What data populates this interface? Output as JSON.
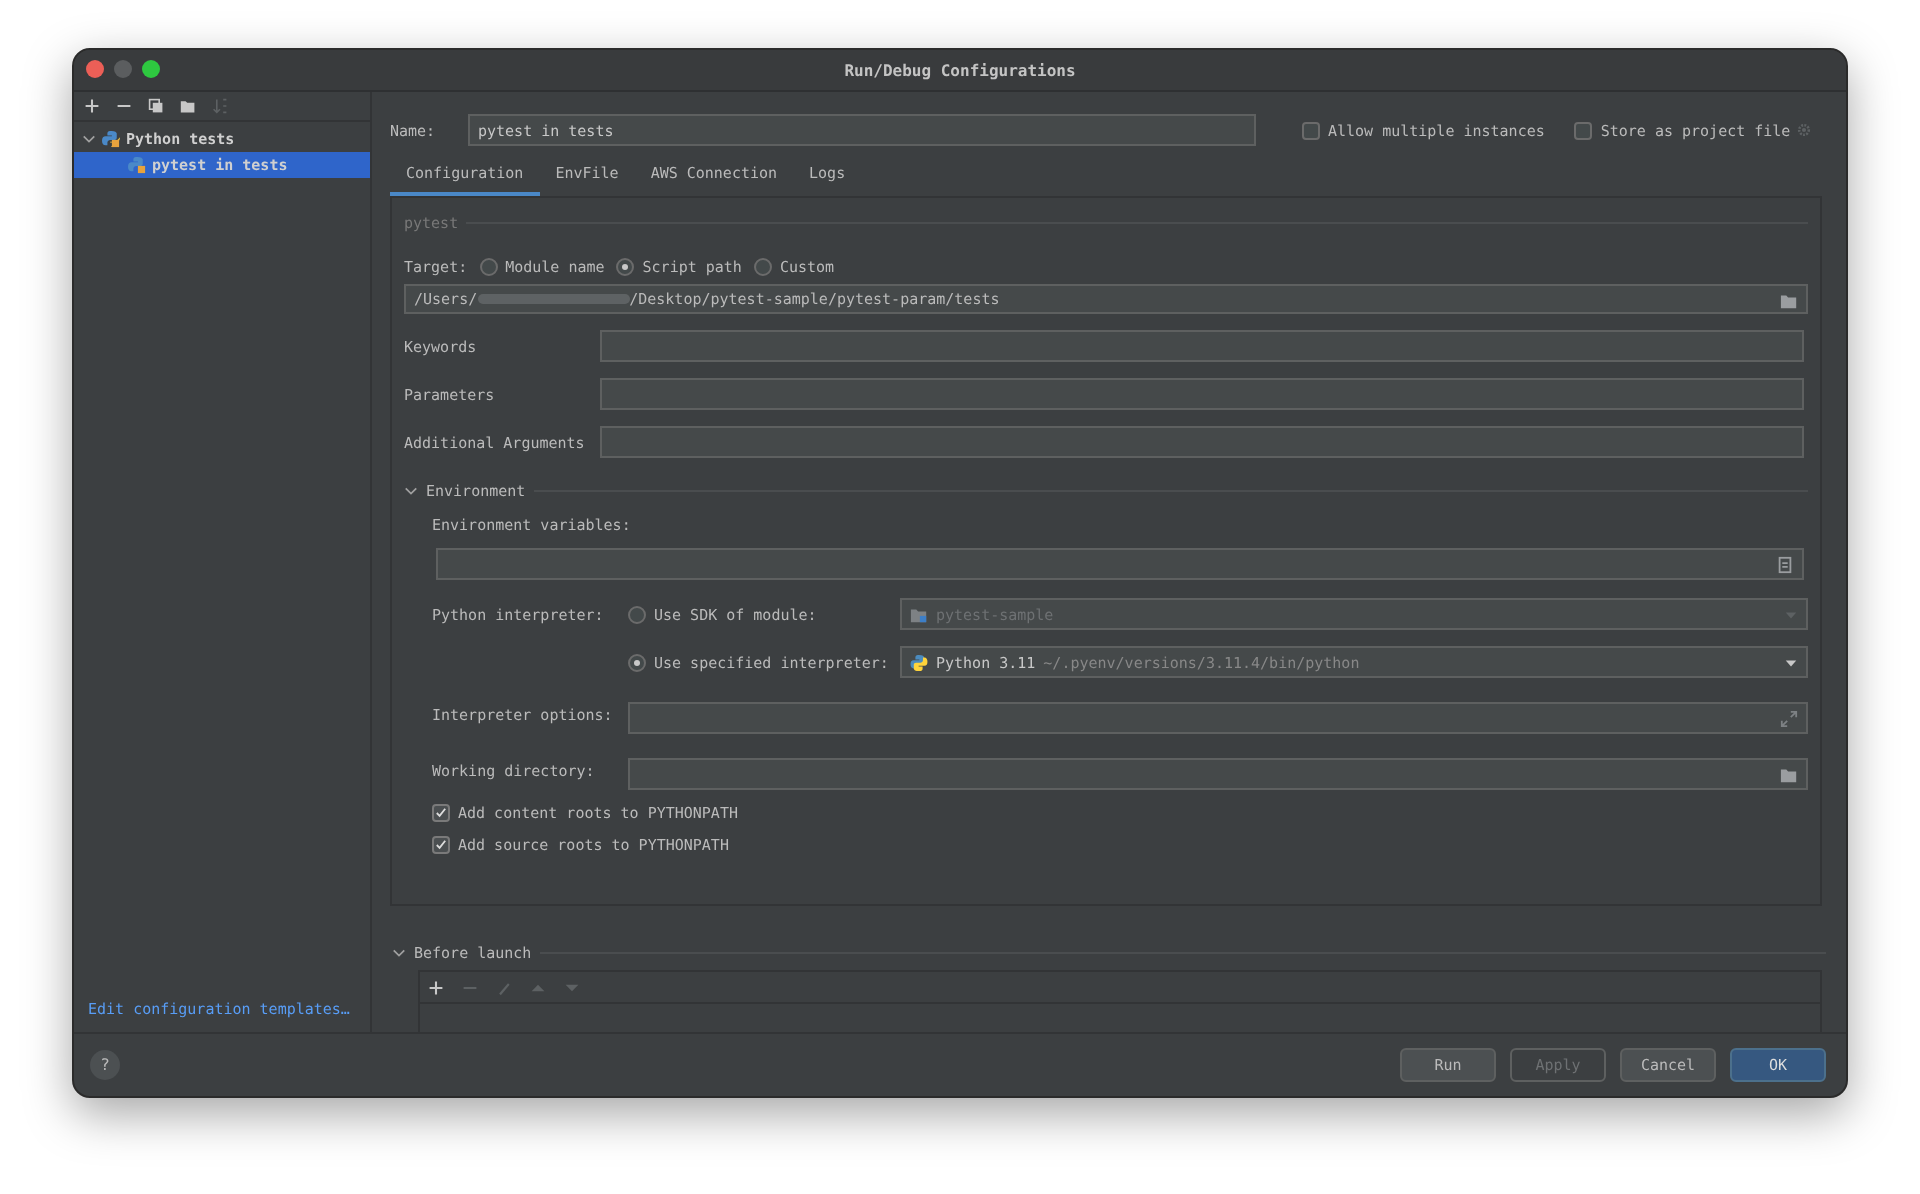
{
  "window": {
    "title": "Run/Debug Configurations"
  },
  "sidebar": {
    "toolbar": [
      {
        "kind": "add",
        "disabled": false
      },
      {
        "kind": "remove",
        "disabled": false
      },
      {
        "kind": "copy",
        "disabled": false
      },
      {
        "kind": "folder",
        "disabled": false
      },
      {
        "kind": "sort",
        "disabled": true
      }
    ],
    "tree": [
      {
        "label": "Python tests",
        "expanded": true,
        "selected": false,
        "children": [
          {
            "label": "pytest in tests",
            "selected": true
          }
        ]
      }
    ],
    "link": "Edit configuration templates…"
  },
  "name": {
    "label": "Name:",
    "value": "pytest in tests"
  },
  "options": [
    {
      "label": "Allow multiple instances",
      "checked": false
    },
    {
      "label": "Store as project file",
      "checked": false
    }
  ],
  "tabs": [
    {
      "label": "Configuration",
      "selected": true
    },
    {
      "label": "EnvFile",
      "selected": false
    },
    {
      "label": "AWS Connection",
      "selected": false
    },
    {
      "label": "Logs",
      "selected": false
    }
  ],
  "pytest": {
    "heading": "pytest",
    "target_label": "Target:",
    "targets": [
      {
        "label": "Module name",
        "selected": false
      },
      {
        "label": "Script path",
        "selected": true
      },
      {
        "label": "Custom",
        "selected": false
      }
    ],
    "path": {
      "prefix": "/Users/",
      "suffix": "/Desktop/pytest-sample/pytest-param/tests"
    },
    "fields": [
      {
        "label": "Keywords"
      },
      {
        "label": "Parameters"
      },
      {
        "label": "Additional Arguments"
      }
    ]
  },
  "environment": {
    "heading": "Environment",
    "expanded": true,
    "env_label": "Environment variables:",
    "interpreter_label": "Python interpreter:",
    "interpreters": [
      {
        "label": "Use SDK of module:",
        "selected": false,
        "disabled": true,
        "kind": "module",
        "value": "pytest-sample"
      },
      {
        "label": "Use specified interpreter:",
        "selected": true,
        "disabled": false,
        "kind": "python",
        "value": "Python 3.11",
        "detail": "~/.pyenv/versions/3.11.4/bin/python"
      }
    ],
    "fields": [
      {
        "label": "Interpreter options:",
        "kind": "expand"
      },
      {
        "label": "Working directory:",
        "kind": "folder"
      }
    ],
    "checkboxes": [
      {
        "label": "Add content roots to PYTHONPATH",
        "checked": true
      },
      {
        "label": "Add source roots to PYTHONPATH",
        "checked": true
      }
    ]
  },
  "before_launch": {
    "heading": "Before launch",
    "expanded": true,
    "toolbar": [
      {
        "kind": "add",
        "disabled": false
      },
      {
        "kind": "remove",
        "disabled": true
      },
      {
        "kind": "edit",
        "disabled": true
      },
      {
        "kind": "up",
        "disabled": true
      },
      {
        "kind": "down",
        "disabled": true
      }
    ]
  },
  "help": "?",
  "buttons": [
    {
      "label": "Run",
      "kind": "normal",
      "disabled": false
    },
    {
      "label": "Apply",
      "kind": "normal",
      "disabled": true
    },
    {
      "label": "Cancel",
      "kind": "normal",
      "disabled": false
    },
    {
      "label": "OK",
      "kind": "default",
      "disabled": false
    }
  ]
}
